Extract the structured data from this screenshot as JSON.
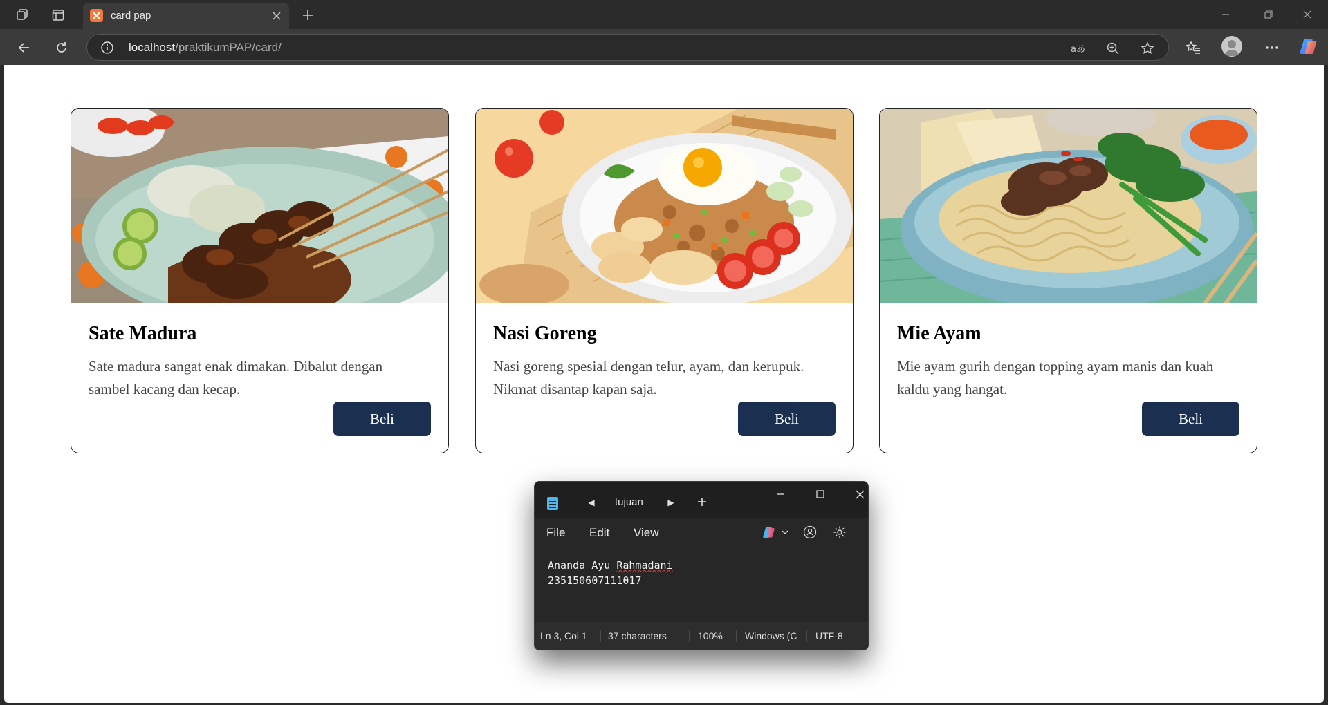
{
  "browser": {
    "tab_title": "card pap",
    "url_host": "localhost",
    "url_path": "/praktikumPAP/card/"
  },
  "cards": [
    {
      "title": "Sate Madura",
      "description": "Sate madura sangat enak dimakan. Dibalut dengan sambel kacang dan kecap.",
      "button_label": "Beli",
      "image": "sate-madura-photo"
    },
    {
      "title": "Nasi Goreng",
      "description": "Nasi goreng spesial dengan telur, ayam, dan kerupuk. Nikmat disantap kapan saja.",
      "button_label": "Beli",
      "image": "nasi-goreng-photo"
    },
    {
      "title": "Mie Ayam",
      "description": "Mie ayam gurih dengan topping ayam manis dan kuah kaldu yang hangat.",
      "button_label": "Beli",
      "image": "mie-ayam-photo"
    }
  ],
  "notepad": {
    "tab_title": "tujuan",
    "menu": {
      "file": "File",
      "edit": "Edit",
      "view": "View"
    },
    "lines": [
      "Ananda Ayu ",
      "Rahmadani",
      "235150607111017"
    ],
    "status": {
      "position": "Ln 3, Col 1",
      "characters": "37 characters",
      "zoom": "100%",
      "line_ending": "Windows (C",
      "encoding": "UTF-8"
    }
  },
  "colors": {
    "button_bg": "#1b3050",
    "page_bg": "#ffffff",
    "chrome_bg": "#2b2b2b",
    "notepad_bg": "#272727"
  }
}
